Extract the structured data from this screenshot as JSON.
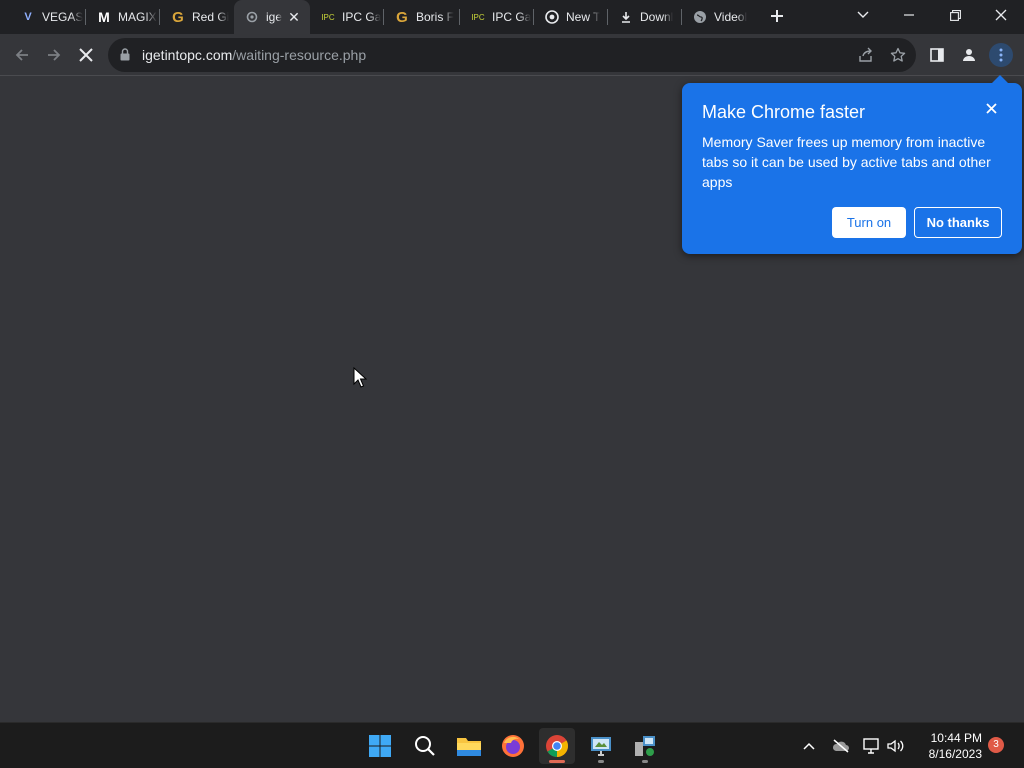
{
  "tabs": [
    {
      "title": "VEGAS",
      "favicon": "vegas-icon",
      "favicon_text": "V",
      "active": false
    },
    {
      "title": "MAGIX",
      "favicon": "magix-icon",
      "favicon_text": "M",
      "active": false
    },
    {
      "title": "Red Gi",
      "favicon": "g-icon",
      "favicon_text": "G",
      "active": false
    },
    {
      "title": "ige",
      "favicon": "loading-icon",
      "favicon_text": "",
      "active": true
    },
    {
      "title": "IPC Ga",
      "favicon": "ipc-icon",
      "favicon_text": "IPC",
      "active": false
    },
    {
      "title": "Boris F",
      "favicon": "g-icon",
      "favicon_text": "G",
      "active": false
    },
    {
      "title": "IPC Ga",
      "favicon": "ipc-icon",
      "favicon_text": "IPC",
      "active": false
    },
    {
      "title": "New T",
      "favicon": "chrome-icon",
      "favicon_text": "",
      "active": false
    },
    {
      "title": "Downl",
      "favicon": "download-icon",
      "favicon_text": "",
      "active": false
    },
    {
      "title": "Videol",
      "favicon": "globe-icon",
      "favicon_text": "",
      "active": false
    }
  ],
  "omnibox": {
    "domain": "igetintopc.com",
    "path": "/waiting-resource.php"
  },
  "bubble": {
    "title": "Make Chrome faster",
    "body": "Memory Saver frees up memory from inactive tabs so it can be used by active tabs and other apps",
    "turn_on_label": "Turn on",
    "no_thanks_label": "No thanks"
  },
  "taskbar": {
    "time": "10:44 PM",
    "date": "8/16/2023",
    "notification_count": "3"
  },
  "colors": {
    "accent": "#1a73e8",
    "tabstrip": "#202124",
    "page": "#35363a"
  }
}
